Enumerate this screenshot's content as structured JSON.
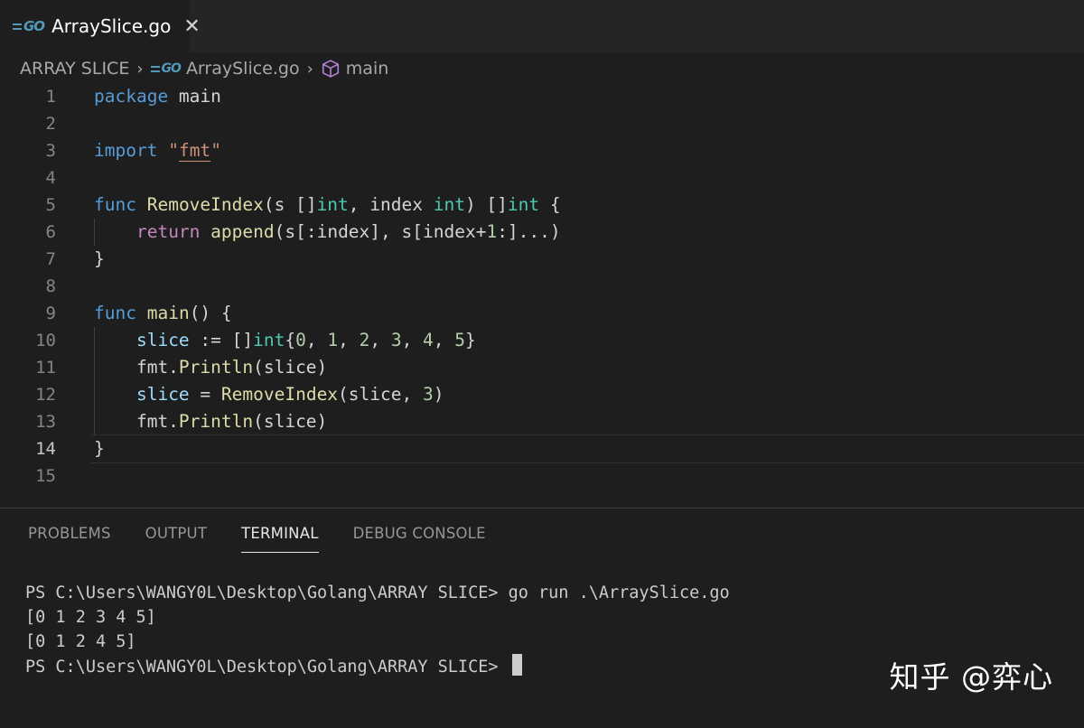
{
  "tab": {
    "icon": "go-file-icon",
    "title": "ArraySlice.go",
    "close_label": "✕"
  },
  "breadcrumb": {
    "folder": "ARRAY SLICE",
    "file": "ArraySlice.go",
    "symbol": "main"
  },
  "editor": {
    "active_line": 14,
    "line_numbers": [
      "1",
      "2",
      "3",
      "4",
      "5",
      "6",
      "7",
      "8",
      "9",
      "10",
      "11",
      "12",
      "13",
      "14",
      "15"
    ]
  },
  "panel": {
    "tabs": [
      "PROBLEMS",
      "OUTPUT",
      "TERMINAL",
      "DEBUG CONSOLE"
    ],
    "active_tab": "TERMINAL"
  },
  "terminal": {
    "lines": [
      "PS C:\\Users\\WANGY0L\\Desktop\\Golang\\ARRAY SLICE> go run .\\ArraySlice.go",
      "[0 1 2 3 4 5]",
      "[0 1 2 4 5]",
      "PS C:\\Users\\WANGY0L\\Desktop\\Golang\\ARRAY SLICE> "
    ]
  },
  "watermark": "知乎 @弈心",
  "colors": {
    "background": "#1e1e1e",
    "keyword": "#569cd6",
    "control": "#c586c0",
    "function": "#dcdcaa",
    "type": "#4ec9b0",
    "string": "#ce9178",
    "number": "#b5cea8",
    "variable": "#9cdcfe"
  }
}
